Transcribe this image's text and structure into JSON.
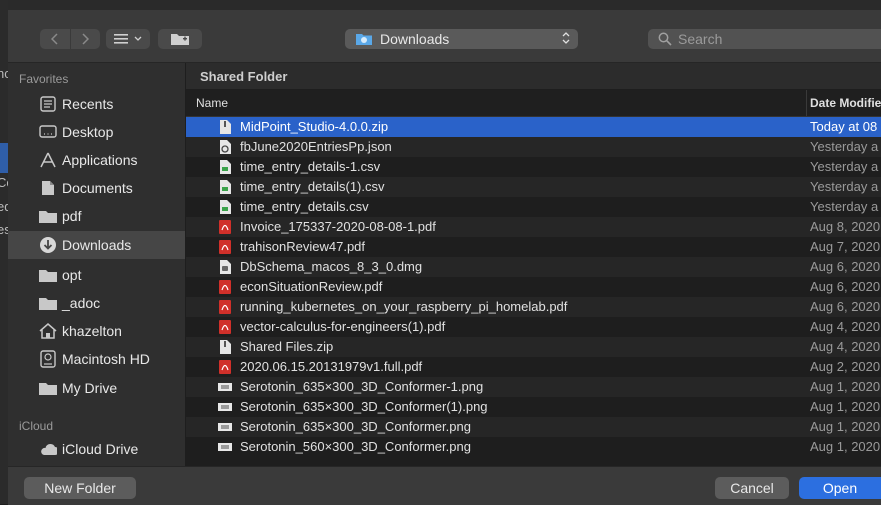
{
  "toolbar": {
    "location": "Downloads",
    "search_placeholder": "Search"
  },
  "sidebar": {
    "favorites_label": "Favorites",
    "icloud_label": "iCloud",
    "items": [
      {
        "label": "Recents",
        "icon": "clock-icon"
      },
      {
        "label": "Desktop",
        "icon": "desktop-icon"
      },
      {
        "label": "Applications",
        "icon": "applications-icon"
      },
      {
        "label": "Documents",
        "icon": "document-icon"
      },
      {
        "label": "pdf",
        "icon": "folder-icon"
      },
      {
        "label": "Downloads",
        "icon": "downloads-icon",
        "selected": true
      },
      {
        "label": "opt",
        "icon": "folder-icon"
      },
      {
        "label": "_adoc",
        "icon": "folder-icon"
      },
      {
        "label": "khazelton",
        "icon": "home-icon"
      },
      {
        "label": "Macintosh HD",
        "icon": "harddisk-icon"
      },
      {
        "label": "My Drive",
        "icon": "folder-icon"
      }
    ],
    "icloud_items": [
      {
        "label": "iCloud Drive",
        "icon": "cloud-icon"
      }
    ]
  },
  "file_list": {
    "section_title": "Shared Folder",
    "columns": [
      "Name",
      "Date Modifie"
    ],
    "rows": [
      {
        "name": "MidPoint_Studio-4.0.0.zip",
        "date": "Today at 08",
        "type": "zip",
        "selected": true
      },
      {
        "name": "fbJune2020EntriesPp.json",
        "date": "Yesterday a",
        "type": "json"
      },
      {
        "name": "time_entry_details-1.csv",
        "date": "Yesterday a",
        "type": "csv"
      },
      {
        "name": "time_entry_details(1).csv",
        "date": "Yesterday a",
        "type": "csv"
      },
      {
        "name": "time_entry_details.csv",
        "date": "Yesterday a",
        "type": "csv"
      },
      {
        "name": "Invoice_175337-2020-08-08-1.pdf",
        "date": "Aug 8, 2020",
        "type": "pdf"
      },
      {
        "name": "trahisonReview47.pdf",
        "date": "Aug 7, 2020",
        "type": "pdf"
      },
      {
        "name": "DbSchema_macos_8_3_0.dmg",
        "date": "Aug 6, 2020",
        "type": "dmg"
      },
      {
        "name": "econSituationReview.pdf",
        "date": "Aug 6, 2020",
        "type": "pdf"
      },
      {
        "name": "running_kubernetes_on_your_raspberry_pi_homelab.pdf",
        "date": "Aug 6, 2020",
        "type": "pdf"
      },
      {
        "name": "vector-calculus-for-engineers(1).pdf",
        "date": "Aug 4, 2020",
        "type": "pdf"
      },
      {
        "name": "Shared Files.zip",
        "date": "Aug 4, 2020",
        "type": "zip"
      },
      {
        "name": "2020.06.15.20131979v1.full.pdf",
        "date": "Aug 2, 2020",
        "type": "pdf"
      },
      {
        "name": "Serotonin_635×300_3D_Conformer-1.png",
        "date": "Aug 1, 2020",
        "type": "png"
      },
      {
        "name": "Serotonin_635×300_3D_Conformer(1).png",
        "date": "Aug 1, 2020",
        "type": "png"
      },
      {
        "name": "Serotonin_635×300_3D_Conformer.png",
        "date": "Aug 1, 2020",
        "type": "png"
      },
      {
        "name": "Serotonin_560×300_3D_Conformer.png",
        "date": "Aug 1, 2020",
        "type": "png"
      }
    ]
  },
  "footer": {
    "new_folder": "New Folder",
    "cancel": "Cancel",
    "open": "Open"
  },
  "background_fragments": [
    "nc",
    "Co",
    "ed",
    "es"
  ],
  "colors": {
    "accent": "#2c6fe0",
    "selection": "#2a62c9",
    "pdf": "#d0302a",
    "csv": "#3aa24a"
  }
}
